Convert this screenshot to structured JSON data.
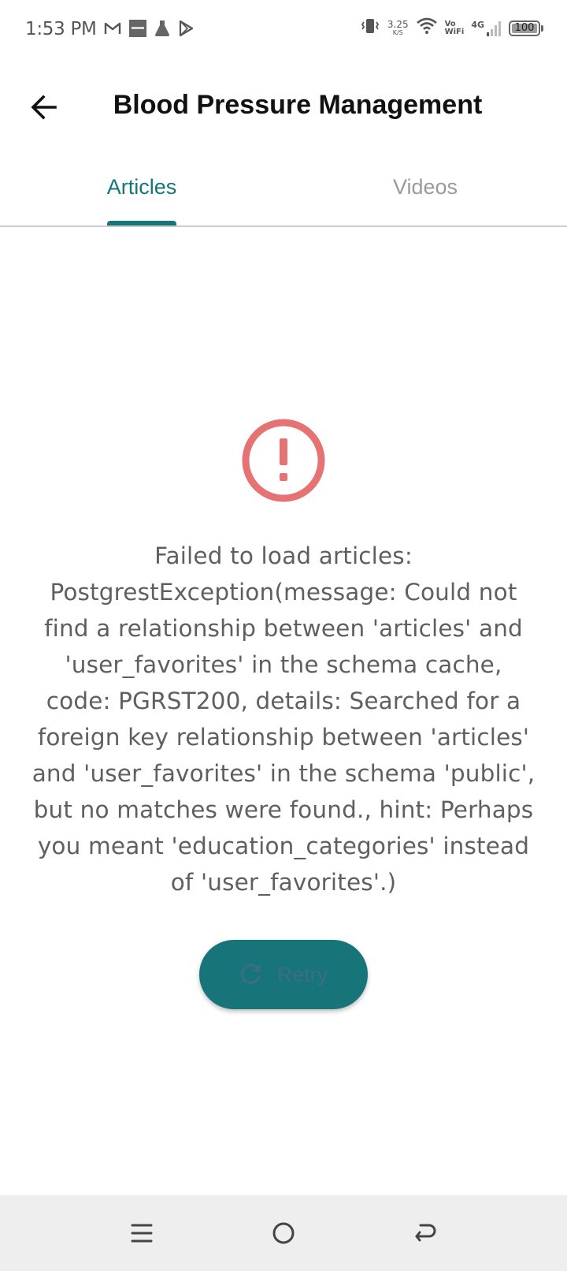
{
  "status_bar": {
    "time": "1:53 PM",
    "left_icons": [
      "gmail-icon",
      "zomato-icon",
      "flask-icon",
      "play-store-icon"
    ],
    "net_speed_value": "3.25",
    "net_speed_unit": "K/S",
    "vowifi_top": "Vo",
    "vowifi_bottom": "WiFi",
    "network_type": "4G",
    "battery": "100"
  },
  "app_bar": {
    "title": "Blood Pressure Management"
  },
  "tabs": [
    {
      "label": "Articles",
      "selected": true
    },
    {
      "label": "Videos",
      "selected": false
    }
  ],
  "error": {
    "message": "Failed to load articles: PostgrestException(message: Could not find a relationship between 'articles' and 'user_favorites' in the schema cache, code: PGRST200, details: Searched for a foreign key relationship between 'articles' and 'user_favorites' in the schema 'public', but no matches were found., hint: Perhaps you meant 'education_categories' instead of 'user_favorites'.)",
    "retry_label": "Retry"
  },
  "colors": {
    "accent": "#17757a",
    "error": "#e57373",
    "tab_inactive": "#9a9a9a"
  }
}
